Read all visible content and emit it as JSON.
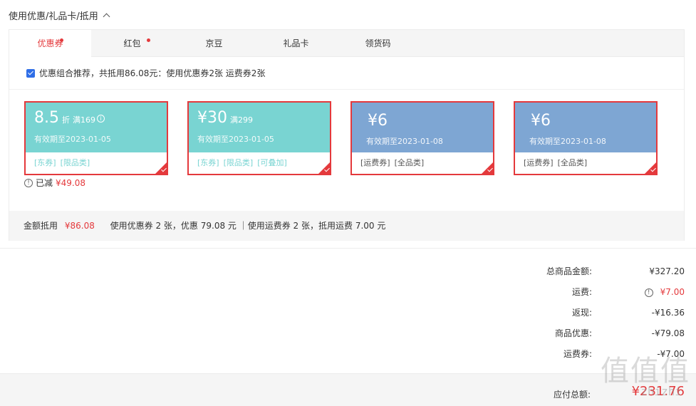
{
  "section": {
    "title": "使用优惠/礼品卡/抵用"
  },
  "tabs": [
    {
      "label": "优惠券",
      "dot": true,
      "active": true
    },
    {
      "label": "红包",
      "dot": true,
      "active": false
    },
    {
      "label": "京豆",
      "dot": false,
      "active": false
    },
    {
      "label": "礼品卡",
      "dot": false,
      "active": false
    },
    {
      "label": "领货码",
      "dot": false,
      "active": false
    }
  ],
  "combo": {
    "text": "优惠组合推荐，共抵用86.08元：使用优惠券2张 运费券2张",
    "checked": true
  },
  "coupons": [
    {
      "amount": "8.5",
      "unit": "折",
      "condition": "满169",
      "validity": "有效期至2023-01-05",
      "tags": [
        "[东券]",
        "[限品类]"
      ],
      "style": "teal"
    },
    {
      "amount": "¥30",
      "unit": "",
      "condition": "满299",
      "validity": "有效期至2023-01-05",
      "tags": [
        "[东券]",
        "[限品类]",
        "[可叠加]"
      ],
      "style": "teal"
    },
    {
      "amount": "¥6",
      "unit": "",
      "condition": "",
      "validity": "有效期至2023-01-08",
      "tags": [
        "[运费券]",
        "[全品类]"
      ],
      "style": "blue"
    },
    {
      "amount": "¥6",
      "unit": "",
      "condition": "",
      "validity": "有效期至2023-01-08",
      "tags": [
        "[运费券]",
        "[全品类]"
      ],
      "style": "blue"
    }
  ],
  "reduced": {
    "label": "已减",
    "value": "¥49.08"
  },
  "summary": {
    "label": "金额抵用",
    "value": "¥86.08",
    "detail": "使用优惠券 2 张，优惠 79.08 元 ｜使用运费券 2 张，抵用运费 7.00 元"
  },
  "totals": [
    {
      "label": "总商品金额:",
      "value": "¥327.20"
    },
    {
      "label": "运费:",
      "value": "¥7.00"
    },
    {
      "label": "返现:",
      "value": "-¥16.36"
    },
    {
      "label": "商品优惠:",
      "value": "-¥79.08"
    },
    {
      "label": "运费券:",
      "value": "-¥7.00"
    }
  ],
  "due": {
    "label": "应付总额:",
    "value": "¥231.76"
  },
  "watermark": {
    "text": "值值值",
    "sub": "zhizhi"
  },
  "colors": {
    "accent": "#e4393c",
    "teal": "#79d4d2",
    "blue": "#7ea6d3"
  }
}
